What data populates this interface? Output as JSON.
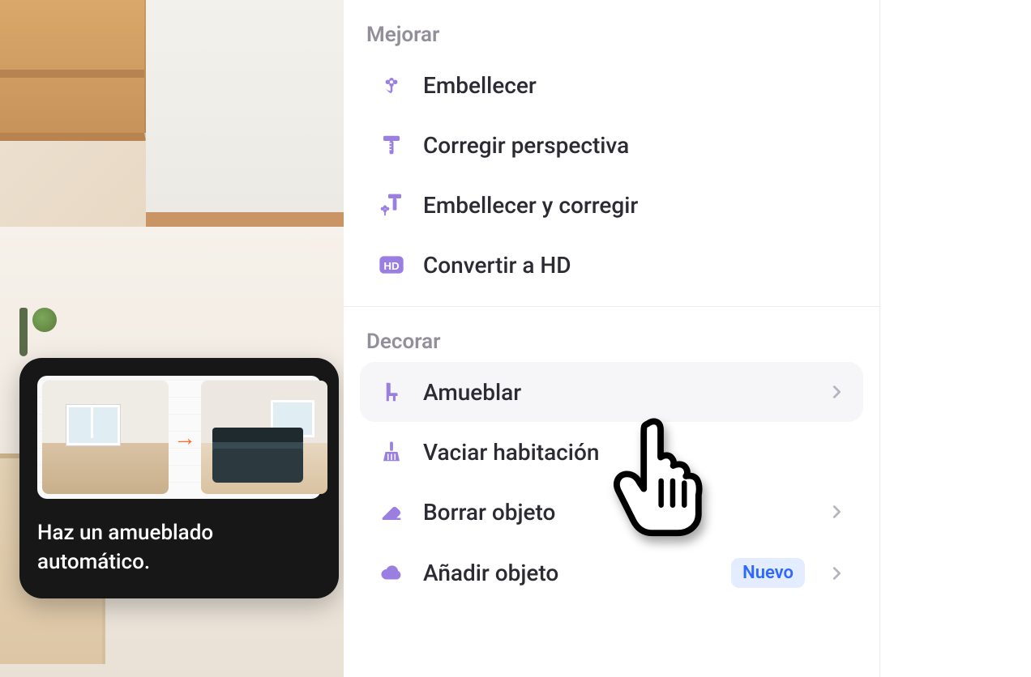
{
  "colors": {
    "accent": "#9b7fe0",
    "badge_bg": "#e4ecff",
    "badge_text": "#2f68ff"
  },
  "tooltip": {
    "text": "Haz un amueblado automático.",
    "arrow_glyph": "→"
  },
  "sections": [
    {
      "title": "Mejorar",
      "items": [
        {
          "icon": "flower-icon",
          "label": "Embellecer",
          "has_chevron": false,
          "badge": null
        },
        {
          "icon": "t-ruler-icon",
          "label": "Corregir perspectiva",
          "has_chevron": false,
          "badge": null
        },
        {
          "icon": "flower-ruler-icon",
          "label": "Embellecer y corregir",
          "has_chevron": false,
          "badge": null
        },
        {
          "icon": "hd-icon",
          "label": "Convertir a HD",
          "has_chevron": false,
          "badge": null
        }
      ]
    },
    {
      "title": "Decorar",
      "items": [
        {
          "icon": "chair-icon",
          "label": "Amueblar",
          "has_chevron": true,
          "badge": null,
          "hovered": true
        },
        {
          "icon": "broom-icon",
          "label": "Vaciar habitación",
          "has_chevron": false,
          "badge": null
        },
        {
          "icon": "eraser-icon",
          "label": "Borrar objeto",
          "has_chevron": true,
          "badge": null
        },
        {
          "icon": "cloud-icon",
          "label": "Añadir objeto",
          "has_chevron": true,
          "badge": "Nuevo"
        }
      ]
    }
  ]
}
